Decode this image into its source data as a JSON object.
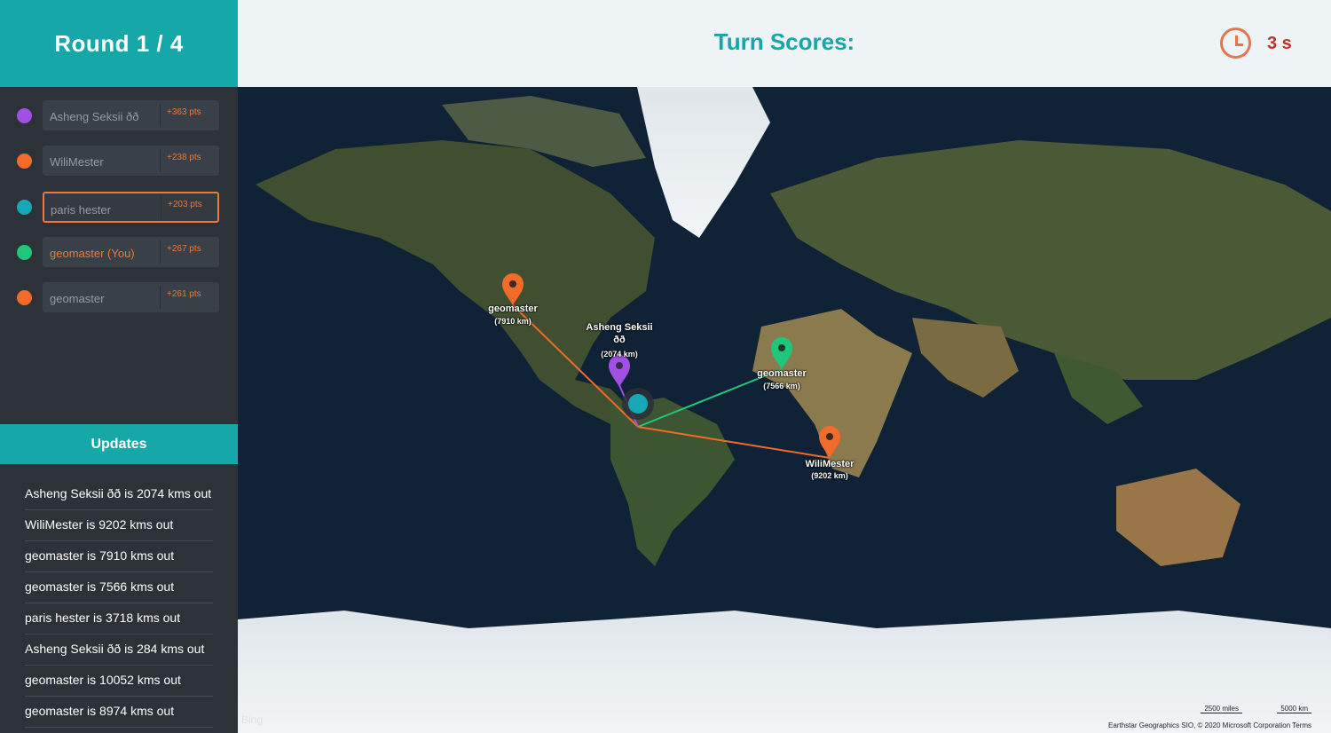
{
  "sidebar": {
    "round_title": "Round 1 / 4",
    "players": [
      {
        "name": "Asheng Seksii ðð",
        "pts": "+363 pts",
        "color": "#a24fe5"
      },
      {
        "name": "WiliMester",
        "pts": "+238 pts",
        "color": "#f26b2a"
      },
      {
        "name": "paris hester",
        "pts": "+203 pts",
        "color": "#18a7b5"
      },
      {
        "name": "geomaster (You)",
        "pts": "+267 pts",
        "color": "#1fc77a"
      },
      {
        "name": "geomaster",
        "pts": "+261 pts",
        "color": "#f26b2a"
      }
    ],
    "updates_title": "Updates",
    "updates": [
      "Asheng Seksii ðð is 2074 kms out",
      "WiliMester is 9202 kms out",
      "geomaster is 7910 kms out",
      "geomaster is 7566 kms out",
      "paris hester is 3718 kms out",
      "Asheng Seksii ðð is 284 kms out",
      "geomaster is 10052 kms out",
      "geomaster is 8974 kms out"
    ]
  },
  "topbar": {
    "title": "Turn Scores:",
    "timer": "3 s",
    "timer_icon": "clock-icon"
  },
  "map": {
    "markers": [
      {
        "name": "geomaster",
        "dist": "(7910 km)",
        "color": "#f26b2a"
      },
      {
        "name": "Asheng Seksii",
        "name2": "ðð",
        "dist": "(2074 km)",
        "color": "#a24fe5"
      },
      {
        "name": "geomaster",
        "dist": "(7566 km)",
        "color": "#1fc77a"
      },
      {
        "name": "WiliMester",
        "dist": "(9202 km)",
        "color": "#f26b2a"
      }
    ],
    "bing_logo": "Bing",
    "attribution": "Earthstar Geographics SIO, © 2020 Microsoft Corporation   Terms",
    "scale_miles": "2500 miles",
    "scale_km": "5000 km"
  },
  "colors": {
    "accent": "#16a7a9",
    "orange": "#f0783a",
    "timer_red": "#c4322b"
  }
}
